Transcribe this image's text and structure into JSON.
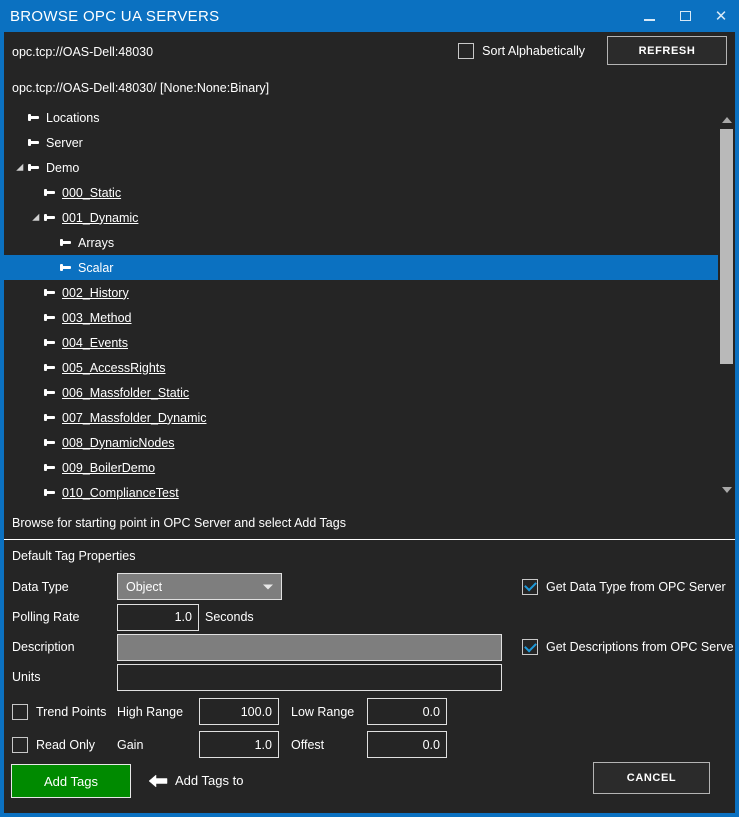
{
  "window": {
    "title": "BROWSE OPC UA SERVERS",
    "accent_color": "#0b71c1",
    "body_color": "#252525",
    "controls": {
      "minimize": "minimize-icon",
      "maximize": "maximize-icon",
      "close": "close-icon"
    }
  },
  "header": {
    "endpoint_url": "opc.tcp://OAS-Dell:48030",
    "endpoint_detail": "opc.tcp://OAS-Dell:48030/ [None:None:Binary]",
    "sort_alphabetically_label": "Sort Alphabetically",
    "sort_alphabetically_checked": false,
    "refresh_label": "REFRESH"
  },
  "tree": {
    "selected": "Scalar",
    "nodes": [
      {
        "label": "Locations",
        "indent": 1,
        "expander": "none",
        "underline": false
      },
      {
        "label": "Server",
        "indent": 1,
        "expander": "none",
        "underline": false
      },
      {
        "label": "Demo",
        "indent": 1,
        "expander": "open",
        "underline": false
      },
      {
        "label": "000_Static",
        "indent": 2,
        "expander": "none",
        "underline": true
      },
      {
        "label": "001_Dynamic",
        "indent": 2,
        "expander": "open",
        "underline": true
      },
      {
        "label": "Arrays",
        "indent": 3,
        "expander": "none",
        "underline": false
      },
      {
        "label": "Scalar",
        "indent": 3,
        "expander": "none",
        "underline": false
      },
      {
        "label": "002_History",
        "indent": 2,
        "expander": "none",
        "underline": true
      },
      {
        "label": "003_Method",
        "indent": 2,
        "expander": "none",
        "underline": true
      },
      {
        "label": "004_Events",
        "indent": 2,
        "expander": "none",
        "underline": true
      },
      {
        "label": "005_AccessRights",
        "indent": 2,
        "expander": "none",
        "underline": true
      },
      {
        "label": "006_Massfolder_Static",
        "indent": 2,
        "expander": "none",
        "underline": true
      },
      {
        "label": "007_Massfolder_Dynamic",
        "indent": 2,
        "expander": "none",
        "underline": true
      },
      {
        "label": "008_DynamicNodes",
        "indent": 2,
        "expander": "none",
        "underline": true
      },
      {
        "label": "009_BoilerDemo",
        "indent": 2,
        "expander": "none",
        "underline": true
      },
      {
        "label": "010_ComplianceTest",
        "indent": 2,
        "expander": "none",
        "underline": true
      }
    ]
  },
  "hint": {
    "text": "Browse for starting point in OPC Server and select Add Tags"
  },
  "properties": {
    "section_title": "Default Tag Properties",
    "data_type": {
      "label": "Data Type",
      "value": "Object",
      "caret": "chevron-down-icon"
    },
    "get_data_type": {
      "label": "Get Data Type from OPC Server",
      "checked": true
    },
    "polling_rate": {
      "label": "Polling Rate",
      "value": "1.0",
      "units": "Seconds"
    },
    "description": {
      "label": "Description",
      "value": "",
      "disabled": true
    },
    "get_descriptions": {
      "label": "Get Descriptions from OPC Serve",
      "checked": true
    },
    "units": {
      "label": "Units",
      "value": ""
    },
    "trend_points": {
      "label": "Trend Points",
      "checked": false
    },
    "read_only": {
      "label": "Read Only",
      "checked": false
    },
    "high_range": {
      "label": "High Range",
      "value": "100.0"
    },
    "low_range": {
      "label": "Low Range",
      "value": "0.0"
    },
    "gain": {
      "label": "Gain",
      "value": "1.0"
    },
    "offset": {
      "label": "Offest",
      "value": "0.0"
    }
  },
  "footer": {
    "add_tags_label": "Add Tags",
    "add_tags_color": "#008a00",
    "arrow_icon": "arrow-left-icon",
    "add_tags_to_label": "Add Tags to",
    "cancel_label": "CANCEL"
  }
}
